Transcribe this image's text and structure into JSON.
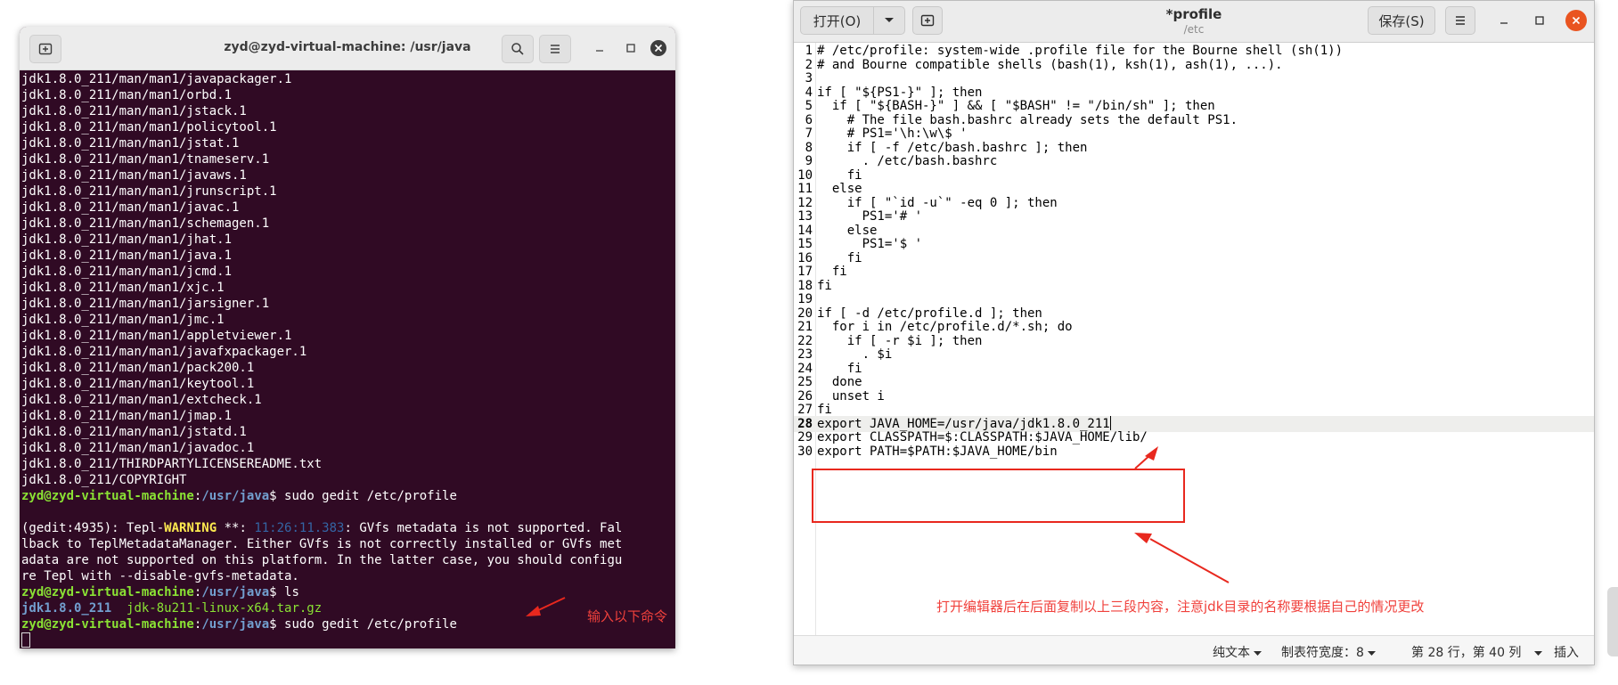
{
  "terminal": {
    "title": "zyd@zyd-virtual-machine: /usr/java",
    "lines": [
      [
        {
          "t": "jdk1.8.0_211/man/man1/javapackager.1"
        }
      ],
      [
        {
          "t": "jdk1.8.0_211/man/man1/orbd.1"
        }
      ],
      [
        {
          "t": "jdk1.8.0_211/man/man1/jstack.1"
        }
      ],
      [
        {
          "t": "jdk1.8.0_211/man/man1/policytool.1"
        }
      ],
      [
        {
          "t": "jdk1.8.0_211/man/man1/jstat.1"
        }
      ],
      [
        {
          "t": "jdk1.8.0_211/man/man1/tnameserv.1"
        }
      ],
      [
        {
          "t": "jdk1.8.0_211/man/man1/javaws.1"
        }
      ],
      [
        {
          "t": "jdk1.8.0_211/man/man1/jrunscript.1"
        }
      ],
      [
        {
          "t": "jdk1.8.0_211/man/man1/javac.1"
        }
      ],
      [
        {
          "t": "jdk1.8.0_211/man/man1/schemagen.1"
        }
      ],
      [
        {
          "t": "jdk1.8.0_211/man/man1/jhat.1"
        }
      ],
      [
        {
          "t": "jdk1.8.0_211/man/man1/java.1"
        }
      ],
      [
        {
          "t": "jdk1.8.0_211/man/man1/jcmd.1"
        }
      ],
      [
        {
          "t": "jdk1.8.0_211/man/man1/xjc.1"
        }
      ],
      [
        {
          "t": "jdk1.8.0_211/man/man1/jarsigner.1"
        }
      ],
      [
        {
          "t": "jdk1.8.0_211/man/man1/jmc.1"
        }
      ],
      [
        {
          "t": "jdk1.8.0_211/man/man1/appletviewer.1"
        }
      ],
      [
        {
          "t": "jdk1.8.0_211/man/man1/javafxpackager.1"
        }
      ],
      [
        {
          "t": "jdk1.8.0_211/man/man1/pack200.1"
        }
      ],
      [
        {
          "t": "jdk1.8.0_211/man/man1/keytool.1"
        }
      ],
      [
        {
          "t": "jdk1.8.0_211/man/man1/extcheck.1"
        }
      ],
      [
        {
          "t": "jdk1.8.0_211/man/man1/jmap.1"
        }
      ],
      [
        {
          "t": "jdk1.8.0_211/man/man1/jstatd.1"
        }
      ],
      [
        {
          "t": "jdk1.8.0_211/man/man1/javadoc.1"
        }
      ],
      [
        {
          "t": "jdk1.8.0_211/THIRDPARTYLICENSEREADME.txt"
        }
      ],
      [
        {
          "t": "jdk1.8.0_211/COPYRIGHT"
        }
      ],
      [
        {
          "t": "zyd@zyd-virtual-machine",
          "c": "g"
        },
        {
          "t": ":"
        },
        {
          "t": "/usr/java",
          "c": "b"
        },
        {
          "t": "$ sudo gedit /etc/profile"
        }
      ],
      [
        {
          "t": ""
        }
      ],
      [
        {
          "t": "(gedit:4935): Tepl-"
        },
        {
          "t": "WARNING",
          "c": "y"
        },
        {
          "t": " **: "
        },
        {
          "t": "11:26:11.383",
          "c": "lb"
        },
        {
          "t": ": GVfs metadata is not supported. Fal"
        }
      ],
      [
        {
          "t": "lback to TeplMetadataManager. Either GVfs is not correctly installed or GVfs met"
        }
      ],
      [
        {
          "t": "adata are not supported on this platform. In the latter case, you should configu"
        }
      ],
      [
        {
          "t": "re Tepl with --disable-gvfs-metadata."
        }
      ],
      [
        {
          "t": "zyd@zyd-virtual-machine",
          "c": "g"
        },
        {
          "t": ":"
        },
        {
          "t": "/usr/java",
          "c": "b"
        },
        {
          "t": "$ ls"
        }
      ],
      [
        {
          "t": "jdk1.8.0_211",
          "c": "b"
        },
        {
          "t": "  "
        },
        {
          "t": "jdk-8u211-linux-x64.tar.gz",
          "c": "tg"
        }
      ],
      [
        {
          "t": "zyd@zyd-virtual-machine",
          "c": "g"
        },
        {
          "t": ":"
        },
        {
          "t": "/usr/java",
          "c": "b"
        },
        {
          "t": "$ sudo gedit /etc/profile"
        }
      ],
      [
        {
          "t": "",
          "cursor": true
        }
      ]
    ],
    "annotation": "输入以下命令"
  },
  "gedit": {
    "open_label": "打开(O)",
    "title": "*profile",
    "subtitle": "/etc",
    "save_label": "保存(S)",
    "lines": [
      "# /etc/profile: system-wide .profile file for the Bourne shell (sh(1))",
      "# and Bourne compatible shells (bash(1), ksh(1), ash(1), ...).",
      "",
      "if [ \"${PS1-}\" ]; then",
      "  if [ \"${BASH-}\" ] && [ \"$BASH\" != \"/bin/sh\" ]; then",
      "    # The file bash.bashrc already sets the default PS1.",
      "    # PS1='\\h:\\w\\$ '",
      "    if [ -f /etc/bash.bashrc ]; then",
      "      . /etc/bash.bashrc",
      "    fi",
      "  else",
      "    if [ \"`id -u`\" -eq 0 ]; then",
      "      PS1='# '",
      "    else",
      "      PS1='$ '",
      "    fi",
      "  fi",
      "fi",
      "",
      "if [ -d /etc/profile.d ]; then",
      "  for i in /etc/profile.d/*.sh; do",
      "    if [ -r $i ]; then",
      "      . $i",
      "    fi",
      "  done",
      "  unset i",
      "fi",
      "export JAVA_HOME=/usr/java/jdk1.8.0_211",
      "export CLASSPATH=$:CLASSPATH:$JAVA_HOME/lib/",
      "export PATH=$PATH:$JAVA_HOME/bin"
    ],
    "current_line": 28,
    "annotation": "打开编辑器后在后面复制以上三段内容，注意jdk目录的名称要根据自己的情况更改",
    "status": {
      "language": "纯文本",
      "tab_width": "制表符宽度：8",
      "position": "第 28 行，第 40 列",
      "mode": "插入"
    }
  },
  "colors": {
    "annotation": "#f0413c",
    "terminal_bg": "#300a24",
    "prompt_user": "#8ae234",
    "prompt_path": "#729fcf"
  }
}
